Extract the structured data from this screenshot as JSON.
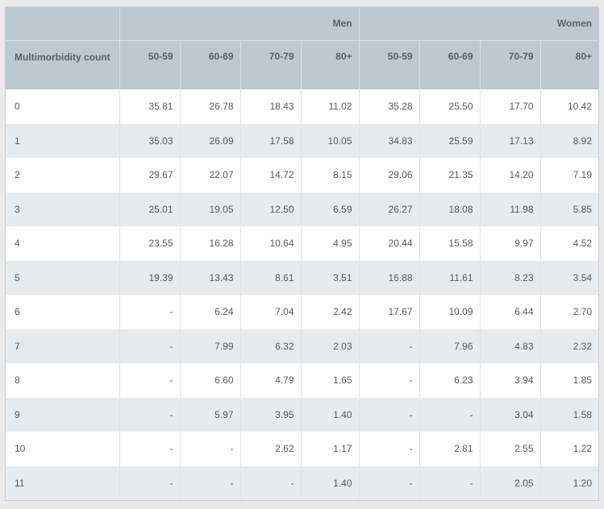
{
  "table": {
    "groups": [
      "Men",
      "Women"
    ],
    "row_header_label": "Multimorbidity count",
    "age_bands": [
      "50-59",
      "60-69",
      "70-79",
      "80+",
      "50-59",
      "60-69",
      "70-79",
      "80+"
    ],
    "rows": [
      {
        "label": "0",
        "cells": [
          "35.81",
          "26.78",
          "18.43",
          "11.02",
          "35.28",
          "25.50",
          "17.70",
          "10.42"
        ]
      },
      {
        "label": "1",
        "cells": [
          "35.03",
          "26.09",
          "17.58",
          "10.05",
          "34.83",
          "25.59",
          "17.13",
          "8.92"
        ]
      },
      {
        "label": "2",
        "cells": [
          "29.67",
          "22.07",
          "14.72",
          "8.15",
          "29.06",
          "21.35",
          "14.20",
          "7.19"
        ]
      },
      {
        "label": "3",
        "cells": [
          "25.01",
          "19.05",
          "12.50",
          "6.59",
          "26.27",
          "18.08",
          "11.98",
          "5.85"
        ]
      },
      {
        "label": "4",
        "cells": [
          "23.55",
          "16.28",
          "10.64",
          "4.95",
          "20.44",
          "15.58",
          "9.97",
          "4.52"
        ]
      },
      {
        "label": "5",
        "cells": [
          "19.39",
          "13.43",
          "8.61",
          "3.51",
          "16.88",
          "11.61",
          "8.23",
          "3.54"
        ]
      },
      {
        "label": "6",
        "cells": [
          "-",
          "6.24",
          "7.04",
          "2.42",
          "17.67",
          "10.09",
          "6.44",
          "2.70"
        ]
      },
      {
        "label": "7",
        "cells": [
          "-",
          "7.99",
          "6.32",
          "2.03",
          "-",
          "7.96",
          "4.83",
          "2.32"
        ]
      },
      {
        "label": "8",
        "cells": [
          "-",
          "6.60",
          "4.79",
          "1.65",
          "-",
          "6.23",
          "3.94",
          "1.85"
        ]
      },
      {
        "label": "9",
        "cells": [
          "-",
          "5.97",
          "3.95",
          "1.40",
          "-",
          "-",
          "3.04",
          "1.58"
        ]
      },
      {
        "label": "10",
        "cells": [
          "-",
          "-",
          "2.62",
          "1.17",
          "-",
          "2.81",
          "2.55",
          "1.22"
        ]
      },
      {
        "label": "11",
        "cells": [
          "-",
          "-",
          "-",
          "1.40",
          "-",
          "-",
          "2.05",
          "1.20"
        ]
      }
    ]
  },
  "colors": {
    "header_bg": "#bcc9d1",
    "row_alt_bg": "#e6ebef",
    "text": "#555b61",
    "page_bg": "#e9e9e9"
  }
}
